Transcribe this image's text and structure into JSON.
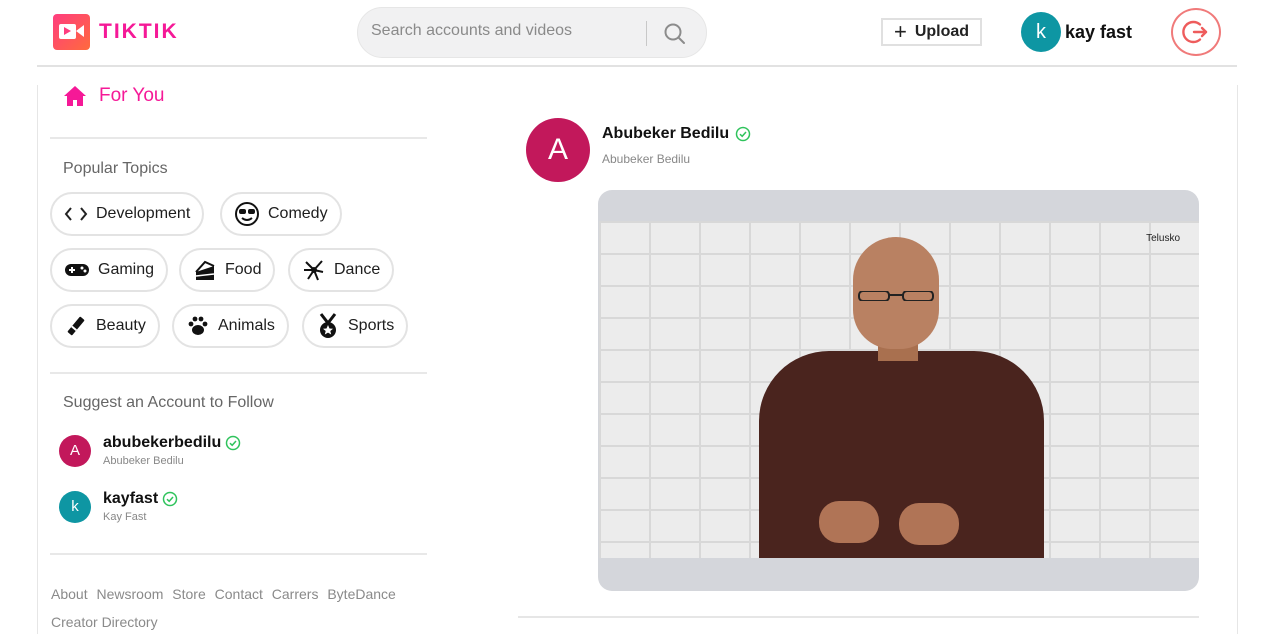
{
  "header": {
    "brand": "TIKTIK",
    "search": {
      "placeholder": "Search accounts and videos",
      "value": ""
    },
    "upload_label": "Upload",
    "user": {
      "initial": "k",
      "name": "kay fast"
    }
  },
  "sidebar": {
    "for_you_label": "For You",
    "topics_title": "Popular Topics",
    "topics": [
      {
        "label": "Development",
        "icon": "code-icon"
      },
      {
        "label": "Comedy",
        "icon": "cool-face-icon"
      },
      {
        "label": "Gaming",
        "icon": "gamepad-icon"
      },
      {
        "label": "Food",
        "icon": "cake-icon"
      },
      {
        "label": "Dance",
        "icon": "dance-icon"
      },
      {
        "label": "Beauty",
        "icon": "lipstick-icon"
      },
      {
        "label": "Animals",
        "icon": "paw-icon"
      },
      {
        "label": "Sports",
        "icon": "medal-icon"
      }
    ],
    "suggest_title": "Suggest an Account to Follow",
    "accounts": [
      {
        "initial": "A",
        "handle": "abubekerbedilu",
        "name": "Abubeker Bedilu",
        "color": "#c2185b"
      },
      {
        "initial": "k",
        "handle": "kayfast",
        "name": "Kay Fast",
        "color": "#0e96a3"
      }
    ],
    "footer_links": [
      "About",
      "Newsroom",
      "Store",
      "Contact",
      "Carrers",
      "ByteDance",
      "Creator Directory"
    ]
  },
  "post": {
    "avatar_initial": "A",
    "author_name": "Abubeker Bedilu",
    "author_sub": "Abubeker Bedilu",
    "video_watermark": "Telusko"
  },
  "colors": {
    "brand_pink": "#f51997",
    "verified_green": "#2fc35c",
    "logout_red": "#f07a7a"
  }
}
